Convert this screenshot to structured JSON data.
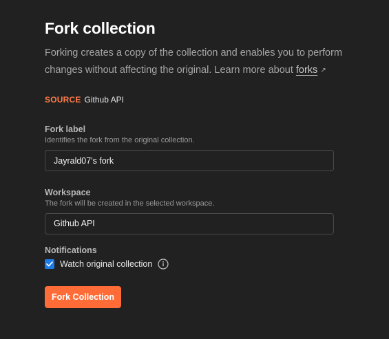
{
  "dialog": {
    "title": "Fork collection",
    "description_text": "Forking creates a copy of the collection and enables you to perform changes without affecting the original. Learn more about ",
    "description_link": "forks",
    "external_link_icon": "external-link-icon"
  },
  "source": {
    "tag": "SOURCE",
    "name": "Github API"
  },
  "fork_label": {
    "label": "Fork label",
    "help": "Identifies the fork from the original collection.",
    "value": "Jayrald07's fork"
  },
  "workspace": {
    "label": "Workspace",
    "help": "The fork will be created in the selected workspace.",
    "value": "Github API"
  },
  "notifications": {
    "label": "Notifications",
    "checkbox_label": "Watch original collection",
    "checked": true,
    "info_icon": "info-icon"
  },
  "actions": {
    "primary_label": "Fork Collection"
  },
  "colors": {
    "background": "#212121",
    "accent": "#ff6c37",
    "source_tag": "#ff7b47",
    "checkbox": "#1d7aeb"
  }
}
